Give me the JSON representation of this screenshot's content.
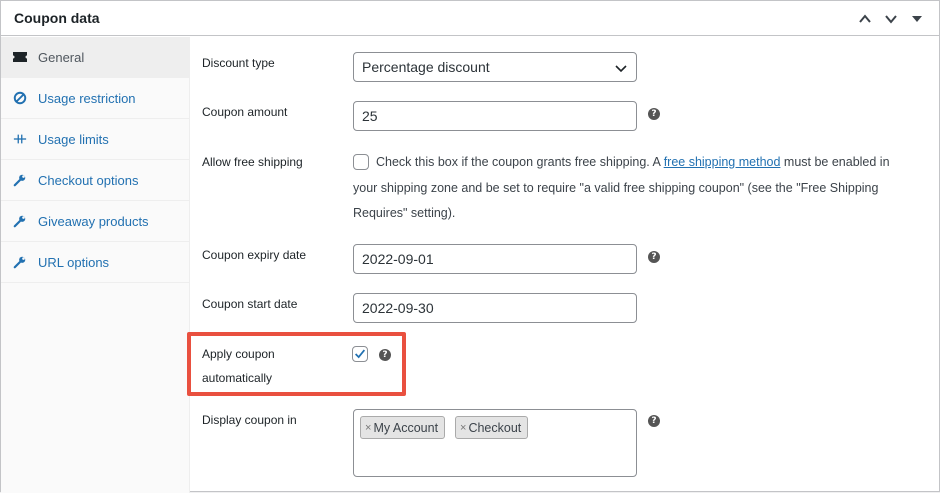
{
  "header": {
    "title": "Coupon data"
  },
  "sidebar": {
    "items": [
      {
        "label": "General",
        "icon": "ticket-icon",
        "active": true
      },
      {
        "label": "Usage restriction",
        "icon": "block-icon",
        "active": false
      },
      {
        "label": "Usage limits",
        "icon": "limits-icon",
        "active": false
      },
      {
        "label": "Checkout options",
        "icon": "wrench-icon",
        "active": false
      },
      {
        "label": "Giveaway products",
        "icon": "wrench-icon",
        "active": false
      },
      {
        "label": "URL options",
        "icon": "wrench-icon",
        "active": false
      }
    ]
  },
  "form": {
    "discount_type": {
      "label": "Discount type",
      "value": "Percentage discount"
    },
    "coupon_amount": {
      "label": "Coupon amount",
      "value": "25"
    },
    "free_shipping": {
      "label": "Allow free shipping",
      "text_before": "Check this box if the coupon grants free shipping. A ",
      "link": "free shipping method",
      "text_after": " must be enabled in your shipping zone and be set to require \"a valid free shipping coupon\" (see the \"Free Shipping Requires\" setting).",
      "checked": false
    },
    "expiry_date": {
      "label": "Coupon expiry date",
      "value": "2022-09-01"
    },
    "start_date": {
      "label": "Coupon start date",
      "value": "2022-09-30"
    },
    "apply_auto": {
      "label_line1": "Apply coupon",
      "label_line2": "automatically",
      "checked": true
    },
    "display_in": {
      "label": "Display coupon in",
      "chips": [
        "My Account",
        "Checkout"
      ]
    }
  },
  "help_glyph": "?",
  "remove_glyph": "×",
  "colors": {
    "link": "#2271b1",
    "highlight": "#e9503f",
    "checkbox_check": "#2271b1"
  }
}
